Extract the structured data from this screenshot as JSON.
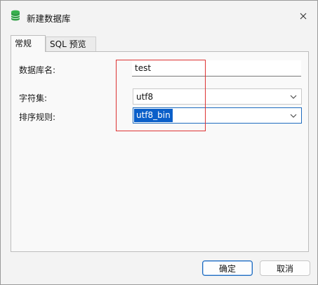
{
  "window": {
    "title": "新建数据库"
  },
  "tabs": [
    {
      "label": "常规",
      "active": true
    },
    {
      "label": "SQL 预览",
      "active": false
    }
  ],
  "form": {
    "db_name_label": "数据库名:",
    "db_name_value": "test",
    "charset_label": "字符集:",
    "charset_value": "utf8",
    "collation_label": "排序规则:",
    "collation_value": "utf8_bin"
  },
  "buttons": {
    "ok_label": "确定",
    "cancel_label": "取消"
  },
  "colors": {
    "accent": "#1f6cbf",
    "selection": "#0a5fc9",
    "annotation_box": "#dd3333",
    "app_icon": "#2f9e44"
  },
  "icons": {
    "app": "database-icon",
    "close": "close-icon",
    "dropdown": "chevron-down-icon"
  }
}
